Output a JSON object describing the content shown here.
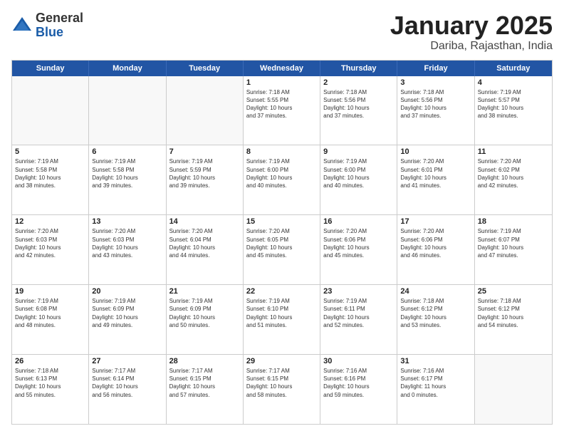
{
  "logo": {
    "general": "General",
    "blue": "Blue"
  },
  "title": "January 2025",
  "subtitle": "Dariba, Rajasthan, India",
  "header_days": [
    "Sunday",
    "Monday",
    "Tuesday",
    "Wednesday",
    "Thursday",
    "Friday",
    "Saturday"
  ],
  "weeks": [
    [
      {
        "day": "",
        "info": ""
      },
      {
        "day": "",
        "info": ""
      },
      {
        "day": "",
        "info": ""
      },
      {
        "day": "1",
        "info": "Sunrise: 7:18 AM\nSunset: 5:55 PM\nDaylight: 10 hours\nand 37 minutes."
      },
      {
        "day": "2",
        "info": "Sunrise: 7:18 AM\nSunset: 5:56 PM\nDaylight: 10 hours\nand 37 minutes."
      },
      {
        "day": "3",
        "info": "Sunrise: 7:18 AM\nSunset: 5:56 PM\nDaylight: 10 hours\nand 37 minutes."
      },
      {
        "day": "4",
        "info": "Sunrise: 7:19 AM\nSunset: 5:57 PM\nDaylight: 10 hours\nand 38 minutes."
      }
    ],
    [
      {
        "day": "5",
        "info": "Sunrise: 7:19 AM\nSunset: 5:58 PM\nDaylight: 10 hours\nand 38 minutes."
      },
      {
        "day": "6",
        "info": "Sunrise: 7:19 AM\nSunset: 5:58 PM\nDaylight: 10 hours\nand 39 minutes."
      },
      {
        "day": "7",
        "info": "Sunrise: 7:19 AM\nSunset: 5:59 PM\nDaylight: 10 hours\nand 39 minutes."
      },
      {
        "day": "8",
        "info": "Sunrise: 7:19 AM\nSunset: 6:00 PM\nDaylight: 10 hours\nand 40 minutes."
      },
      {
        "day": "9",
        "info": "Sunrise: 7:19 AM\nSunset: 6:00 PM\nDaylight: 10 hours\nand 40 minutes."
      },
      {
        "day": "10",
        "info": "Sunrise: 7:20 AM\nSunset: 6:01 PM\nDaylight: 10 hours\nand 41 minutes."
      },
      {
        "day": "11",
        "info": "Sunrise: 7:20 AM\nSunset: 6:02 PM\nDaylight: 10 hours\nand 42 minutes."
      }
    ],
    [
      {
        "day": "12",
        "info": "Sunrise: 7:20 AM\nSunset: 6:03 PM\nDaylight: 10 hours\nand 42 minutes."
      },
      {
        "day": "13",
        "info": "Sunrise: 7:20 AM\nSunset: 6:03 PM\nDaylight: 10 hours\nand 43 minutes."
      },
      {
        "day": "14",
        "info": "Sunrise: 7:20 AM\nSunset: 6:04 PM\nDaylight: 10 hours\nand 44 minutes."
      },
      {
        "day": "15",
        "info": "Sunrise: 7:20 AM\nSunset: 6:05 PM\nDaylight: 10 hours\nand 45 minutes."
      },
      {
        "day": "16",
        "info": "Sunrise: 7:20 AM\nSunset: 6:06 PM\nDaylight: 10 hours\nand 45 minutes."
      },
      {
        "day": "17",
        "info": "Sunrise: 7:20 AM\nSunset: 6:06 PM\nDaylight: 10 hours\nand 46 minutes."
      },
      {
        "day": "18",
        "info": "Sunrise: 7:19 AM\nSunset: 6:07 PM\nDaylight: 10 hours\nand 47 minutes."
      }
    ],
    [
      {
        "day": "19",
        "info": "Sunrise: 7:19 AM\nSunset: 6:08 PM\nDaylight: 10 hours\nand 48 minutes."
      },
      {
        "day": "20",
        "info": "Sunrise: 7:19 AM\nSunset: 6:09 PM\nDaylight: 10 hours\nand 49 minutes."
      },
      {
        "day": "21",
        "info": "Sunrise: 7:19 AM\nSunset: 6:09 PM\nDaylight: 10 hours\nand 50 minutes."
      },
      {
        "day": "22",
        "info": "Sunrise: 7:19 AM\nSunset: 6:10 PM\nDaylight: 10 hours\nand 51 minutes."
      },
      {
        "day": "23",
        "info": "Sunrise: 7:19 AM\nSunset: 6:11 PM\nDaylight: 10 hours\nand 52 minutes."
      },
      {
        "day": "24",
        "info": "Sunrise: 7:18 AM\nSunset: 6:12 PM\nDaylight: 10 hours\nand 53 minutes."
      },
      {
        "day": "25",
        "info": "Sunrise: 7:18 AM\nSunset: 6:12 PM\nDaylight: 10 hours\nand 54 minutes."
      }
    ],
    [
      {
        "day": "26",
        "info": "Sunrise: 7:18 AM\nSunset: 6:13 PM\nDaylight: 10 hours\nand 55 minutes."
      },
      {
        "day": "27",
        "info": "Sunrise: 7:17 AM\nSunset: 6:14 PM\nDaylight: 10 hours\nand 56 minutes."
      },
      {
        "day": "28",
        "info": "Sunrise: 7:17 AM\nSunset: 6:15 PM\nDaylight: 10 hours\nand 57 minutes."
      },
      {
        "day": "29",
        "info": "Sunrise: 7:17 AM\nSunset: 6:15 PM\nDaylight: 10 hours\nand 58 minutes."
      },
      {
        "day": "30",
        "info": "Sunrise: 7:16 AM\nSunset: 6:16 PM\nDaylight: 10 hours\nand 59 minutes."
      },
      {
        "day": "31",
        "info": "Sunrise: 7:16 AM\nSunset: 6:17 PM\nDaylight: 11 hours\nand 0 minutes."
      },
      {
        "day": "",
        "info": ""
      }
    ]
  ]
}
